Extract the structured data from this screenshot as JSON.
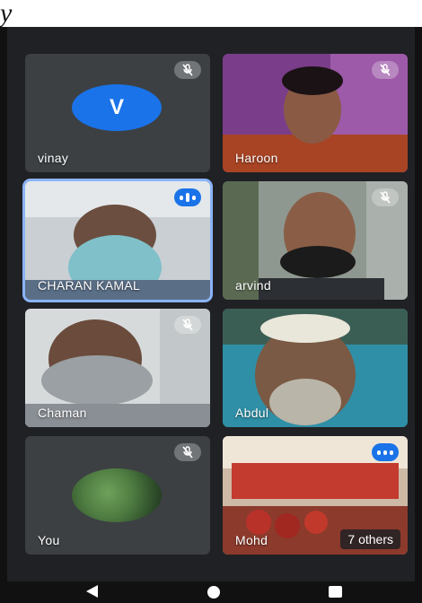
{
  "top_fragment": "y",
  "tiles": [
    {
      "name": "vinay",
      "avatar_letter": "V",
      "status": "muted"
    },
    {
      "name": "Haroon",
      "status": "muted"
    },
    {
      "name": "CHARAN KAMAL",
      "status": "speaking"
    },
    {
      "name": "arvind",
      "status": "muted"
    },
    {
      "name": "Chaman",
      "status": "muted"
    },
    {
      "name": "Abdul",
      "status": "muted"
    },
    {
      "name": "You",
      "status": "muted"
    },
    {
      "name": "Mohd",
      "status": "speaking",
      "others_label": "7 others"
    }
  ],
  "colors": {
    "accent": "#1a73e8",
    "active_border": "#8ab4f8",
    "tile_bg": "#3c4043",
    "grid_bg": "#202124"
  },
  "icons": {
    "mute": "mic-off-icon",
    "speaking": "audio-level-icon",
    "nav": [
      "back-icon",
      "home-icon",
      "recents-icon"
    ]
  }
}
